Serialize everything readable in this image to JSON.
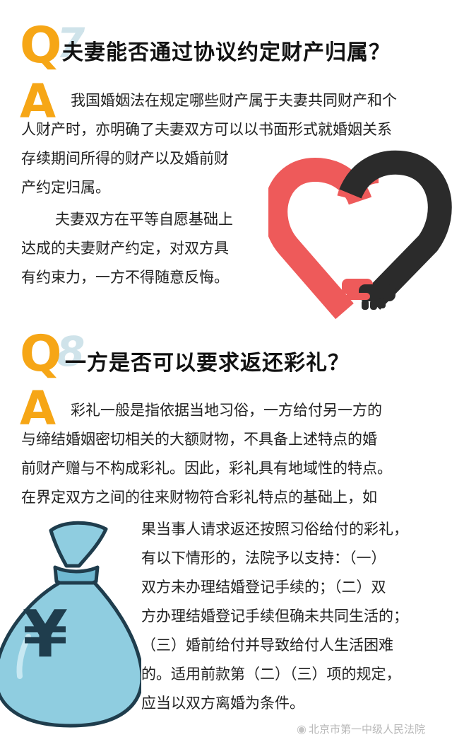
{
  "section1": {
    "q_letter": "Q",
    "q_number": "7",
    "question": "夫妻能否通过协议约定财产归属？",
    "a_letter": "A",
    "answer_lines": [
      "我国婚姻法在规定哪些财产属于夫妻共同财产和个",
      "人财产时，亦明确了夫妻双方可以以书面形式就婚姻关系",
      "存续期间所得的财产以及婚前财",
      "产约定归属。",
      "夫妻双方在平等自愿基础上",
      "达成的夫妻财产约定，对双方具",
      "有约束力，一方不得随意反悔。"
    ]
  },
  "section2": {
    "q_letter": "Q",
    "q_number": "8",
    "question": "一方是否可以要求返还彩礼？",
    "a_letter": "A",
    "answer_lines": [
      "彩礼一般是指依据当地习俗，一方给付另一方的",
      "与缔结婚姻密切相关的大额财物，不具备上述特点的婚",
      "前财产赠与不构成彩礼。因此，彩礼具有地域性的特点。",
      "在界定双方之间的往来财物符合彩礼特点的基础上，如",
      "果当事人请求返还按照习俗给付的彩礼，",
      "有以下情形的，法院予以支持：（一）",
      "双方未办理结婚登记手续的；（二）双",
      "方办理结婚登记手续但确未共同生活的；",
      "（三）婚前给付并导致给付人生活困难",
      "的。适用前款第（二）（三）项的规定，",
      "应当以双方离婚为条件。"
    ]
  },
  "money_bag_symbol": "¥",
  "watermark": {
    "icon": "weibo-icon",
    "text": "北京市第一中级人民法院"
  },
  "colors": {
    "accent_orange": "#f6a616",
    "heart_red": "#ee5a5a",
    "heart_dark": "#2b2b2b",
    "bag_blue": "#8fcde0",
    "bag_dark": "#1f3d4d"
  }
}
